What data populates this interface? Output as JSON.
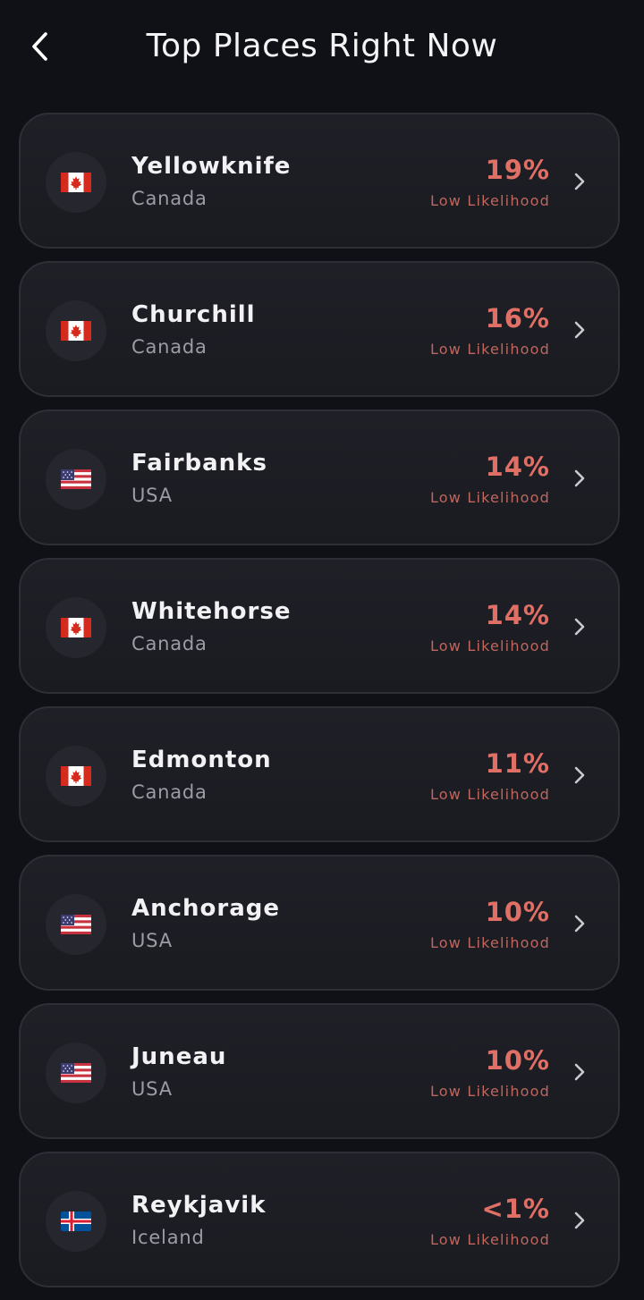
{
  "header": {
    "title": "Top Places Right Now",
    "back_icon": "chevron-left-icon"
  },
  "places": [
    {
      "city": "Yellowknife",
      "country": "Canada",
      "percent": "19%",
      "likelihood": "Low Likelihood",
      "flag": "canada-flag-icon"
    },
    {
      "city": "Churchill",
      "country": "Canada",
      "percent": "16%",
      "likelihood": "Low Likelihood",
      "flag": "canada-flag-icon"
    },
    {
      "city": "Fairbanks",
      "country": "USA",
      "percent": "14%",
      "likelihood": "Low Likelihood",
      "flag": "usa-flag-icon"
    },
    {
      "city": "Whitehorse",
      "country": "Canada",
      "percent": "14%",
      "likelihood": "Low Likelihood",
      "flag": "canada-flag-icon"
    },
    {
      "city": "Edmonton",
      "country": "Canada",
      "percent": "11%",
      "likelihood": "Low Likelihood",
      "flag": "canada-flag-icon"
    },
    {
      "city": "Anchorage",
      "country": "USA",
      "percent": "10%",
      "likelihood": "Low Likelihood",
      "flag": "usa-flag-icon"
    },
    {
      "city": "Juneau",
      "country": "USA",
      "percent": "10%",
      "likelihood": "Low Likelihood",
      "flag": "usa-flag-icon"
    },
    {
      "city": "Reykjavik",
      "country": "Iceland",
      "percent": "<1%",
      "likelihood": "Low Likelihood",
      "flag": "iceland-flag-icon"
    }
  ],
  "colors": {
    "background": "#101116",
    "card": "#1e1f26",
    "card_border": "#2d2f37",
    "percent": "#e07066",
    "likelihood": "#bf665e",
    "country_text": "#9a9ca6"
  }
}
